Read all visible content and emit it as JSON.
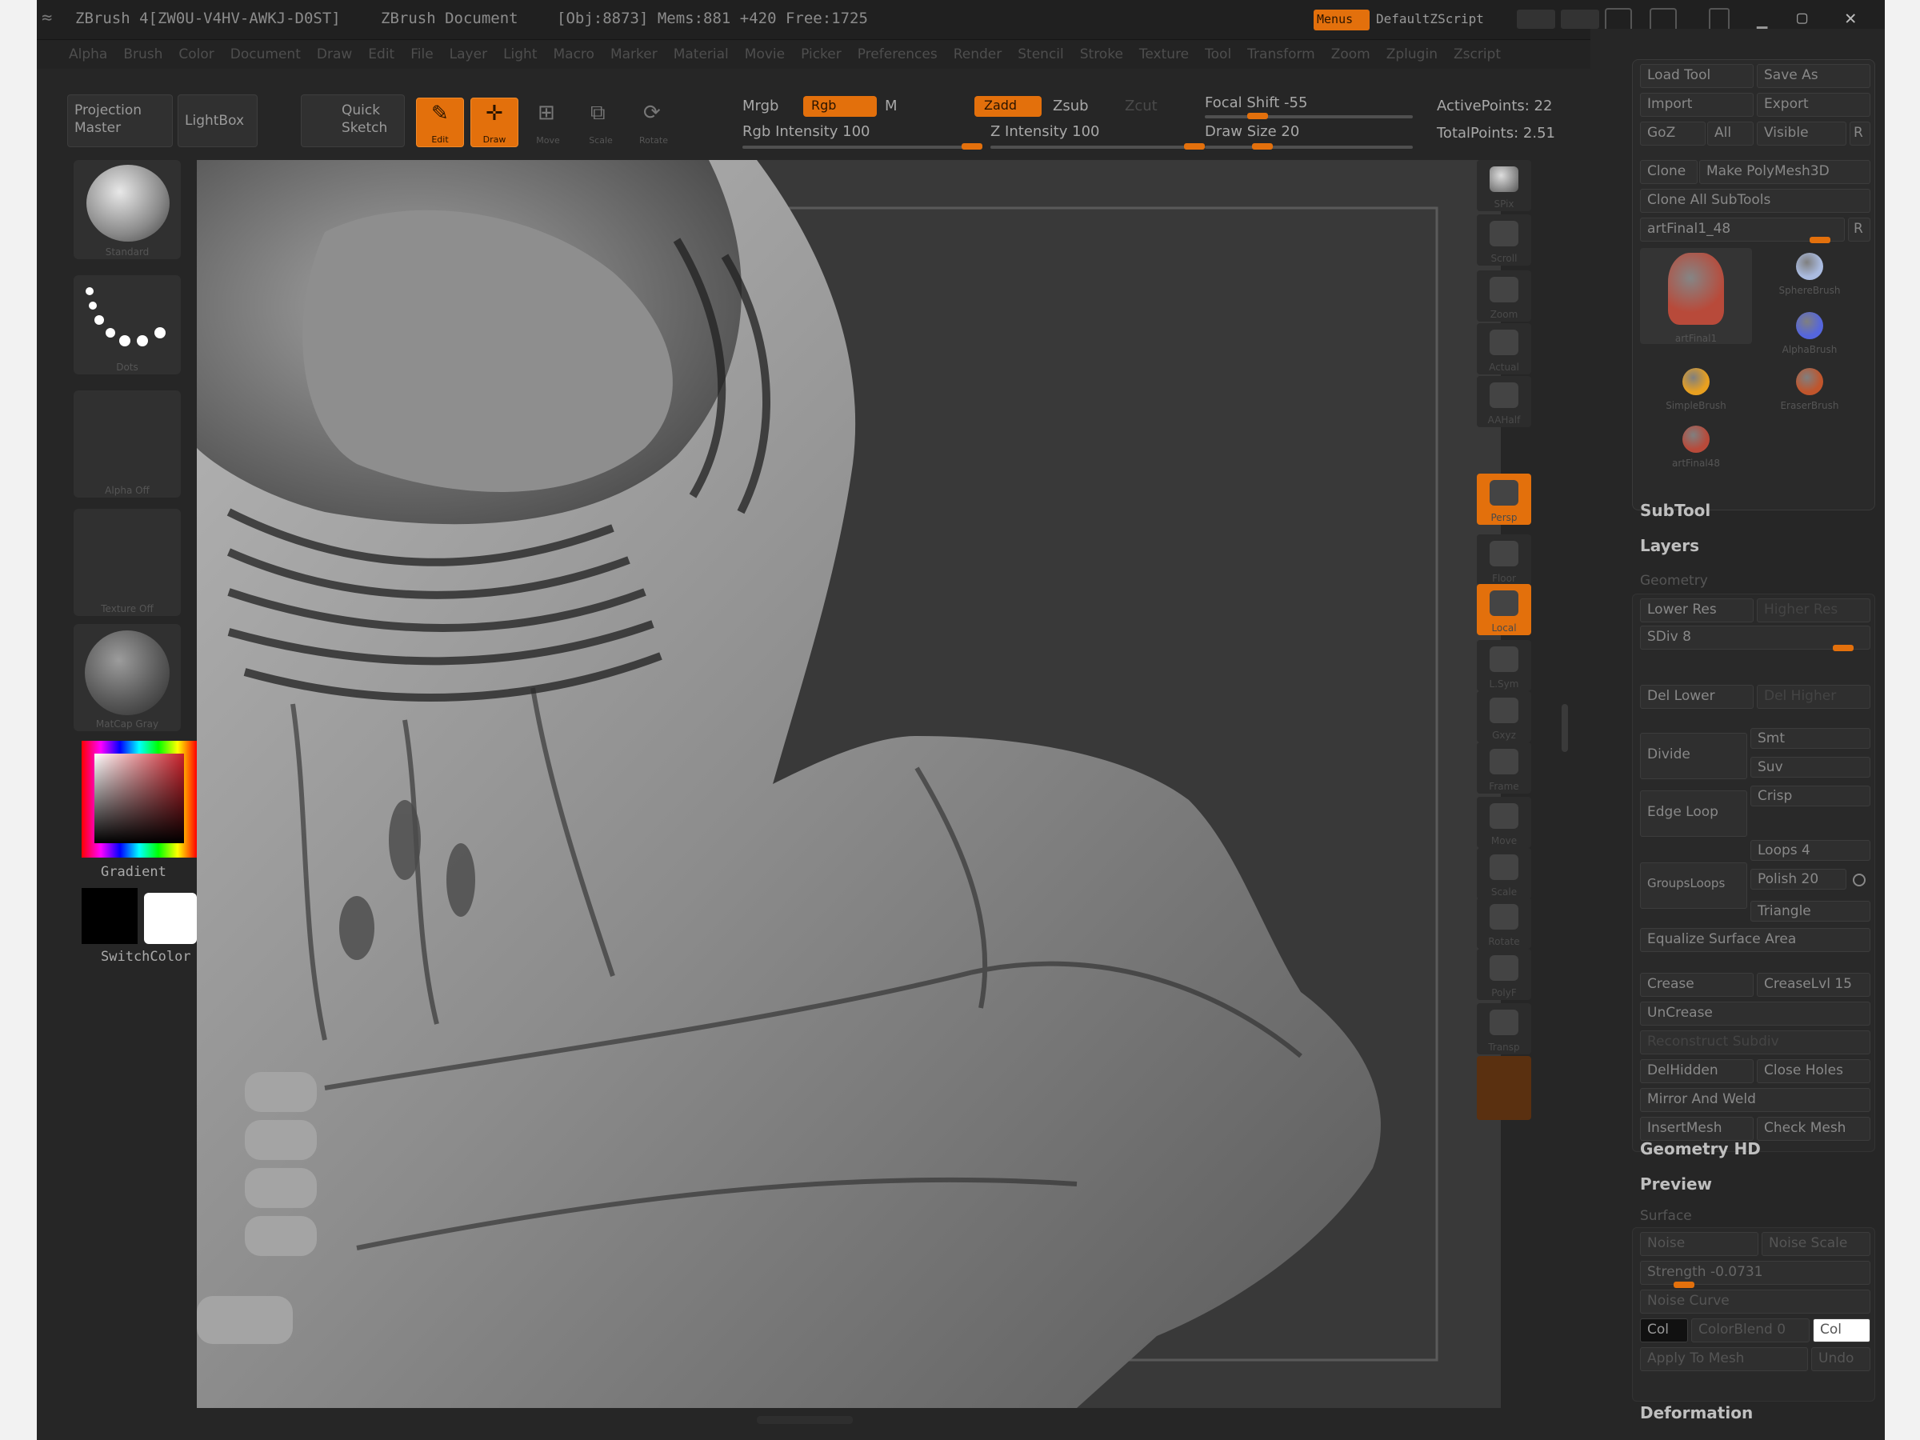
{
  "titlebar": {
    "title": "ZBrush 4[ZW0U-V4HV-AWKJ-D0ST]",
    "document": "ZBrush Document",
    "stats": "[Obj:8873] Mems:881 +420 Free:1725",
    "menus_btn": "Menus",
    "script_btn": "DefaultZScript"
  },
  "menubar": {
    "items": [
      "Alpha",
      "Brush",
      "Color",
      "Document",
      "Draw",
      "Edit",
      "File",
      "Layer",
      "Light",
      "Macro",
      "Marker",
      "Material",
      "Movie",
      "Picker",
      "Preferences",
      "Render",
      "Stencil",
      "Stroke",
      "Texture",
      "Tool",
      "Transform",
      "Zoom",
      "Zplugin",
      "Zscript"
    ]
  },
  "toolbar": {
    "projection_master": "Projection\nMaster",
    "lightbox": "LightBox",
    "quick_sketch": "Quick\nSketch",
    "edit": "Edit",
    "draw": "Draw",
    "move": "Move",
    "scale": "Scale",
    "rotate": "Rotate",
    "mrgb": "Mrgb",
    "rgb": "Rgb",
    "m": "M",
    "rgb_intensity": "Rgb Intensity 100",
    "zadd": "Zadd",
    "zsub": "Zsub",
    "zcut": "Zcut",
    "z_intensity": "Z Intensity 100",
    "focal_shift": "Focal Shift -55",
    "draw_size": "Draw Size 20",
    "active_points": "ActivePoints: 22",
    "total_points": "TotalPoints: 2.51",
    "rgb_intensity_value": 1.0,
    "z_intensity_value": 1.0,
    "focal_shift_value": -55,
    "draw_size_value": 20
  },
  "leftcol": {
    "brush_label": "Standard",
    "stroke_label": "Dots",
    "alpha_label": "Alpha Off",
    "texture_label": "Texture Off",
    "material_label": "MatCap Gray",
    "gradient_label": "Gradient",
    "switchcolor_label": "SwitchColor"
  },
  "rightshelf": {
    "items": [
      {
        "label": "SPix",
        "icon": "sphere-icon"
      },
      {
        "label": "Scroll",
        "icon": "scroll-icon"
      },
      {
        "label": "Zoom",
        "icon": "zoom-icon"
      },
      {
        "label": "Actual",
        "icon": "actual-icon"
      },
      {
        "label": "AAHalf",
        "icon": "aahalf-icon"
      },
      {
        "label": "Persp",
        "icon": "persp-icon"
      },
      {
        "label": "Floor",
        "icon": "floor-icon"
      },
      {
        "label": "Local",
        "icon": "local-icon"
      },
      {
        "label": "L.Sym",
        "icon": "lsym-icon"
      },
      {
        "label": "Gxyz",
        "icon": "xyz-icon"
      },
      {
        "label": "Frame",
        "icon": "frame-icon"
      },
      {
        "label": "Move",
        "icon": "move-icon"
      },
      {
        "label": "Scale",
        "icon": "scale-icon"
      },
      {
        "label": "Rotate",
        "icon": "rotate-icon"
      },
      {
        "label": "PolyF",
        "icon": "polyf-icon"
      },
      {
        "label": "Transp",
        "icon": "transp-icon"
      }
    ]
  },
  "tool": {
    "load_tool": "Load Tool",
    "save_as": "Save As",
    "import": "Import",
    "export": "Export",
    "goz": "GoZ",
    "all": "All",
    "visible": "Visible",
    "r": "R",
    "clone": "Clone",
    "make_polymesh": "Make PolyMesh3D",
    "clone_all": "Clone All SubTools",
    "current_tool": "artFinal1_48",
    "thumbs": [
      {
        "label": "artFinal1",
        "icon": "head-tool-icon"
      },
      {
        "label": "SphereBrush",
        "icon": "sphere-brush-icon"
      },
      {
        "label": "AlphaBrush",
        "icon": "alpha-brush-icon"
      },
      {
        "label": "SimpleBrush",
        "icon": "simple-brush-icon"
      },
      {
        "label": "EraserBrush",
        "icon": "eraser-brush-icon"
      },
      {
        "label": "artFinal48",
        "icon": "small-head-icon"
      }
    ]
  },
  "subtool": "SubTool",
  "layers": "Layers",
  "geometry": {
    "title": "Geometry",
    "lower_res": "Lower Res",
    "higher_res": "Higher Res",
    "sdiv": "SDiv 8",
    "sdiv_value": 8,
    "del_lower": "Del Lower",
    "del_higher": "Del Higher",
    "divide": "Divide",
    "smt": "Smt",
    "suv": "Suv",
    "crisp": "Crisp",
    "edge_loop": "Edge Loop",
    "loops": "Loops 4",
    "polish": "Polish 20",
    "groups_loops": "GroupsLoops",
    "triangle": "Triangle",
    "equalize": "Equalize Surface Area",
    "crease": "Crease",
    "crease_lvl": "CreaseLvl 15",
    "uncrease": "UnCrease",
    "reconstruct": "Reconstruct Subdiv",
    "del_hidden": "DelHidden",
    "close_holes": "Close Holes",
    "mirror_weld": "Mirror And Weld",
    "insert_mesh": "InsertMesh",
    "check_mesh": "Check Mesh"
  },
  "geometry_hd": "Geometry HD",
  "preview": "Preview",
  "surface": {
    "title": "Surface",
    "noise": "Noise",
    "noise_scale": "Noise Scale",
    "strength": "Strength -0.0731",
    "strength_value": -0.0731,
    "noise_curve": "Noise Curve",
    "col": "Col",
    "colorblend": "ColorBlend 0",
    "col2": "Col",
    "apply_to_mesh": "Apply To Mesh",
    "undo": "Undo"
  },
  "deformation": "Deformation",
  "colors": {
    "accent": "#e3700c",
    "bg": "#262626",
    "canvas": "#393939"
  }
}
